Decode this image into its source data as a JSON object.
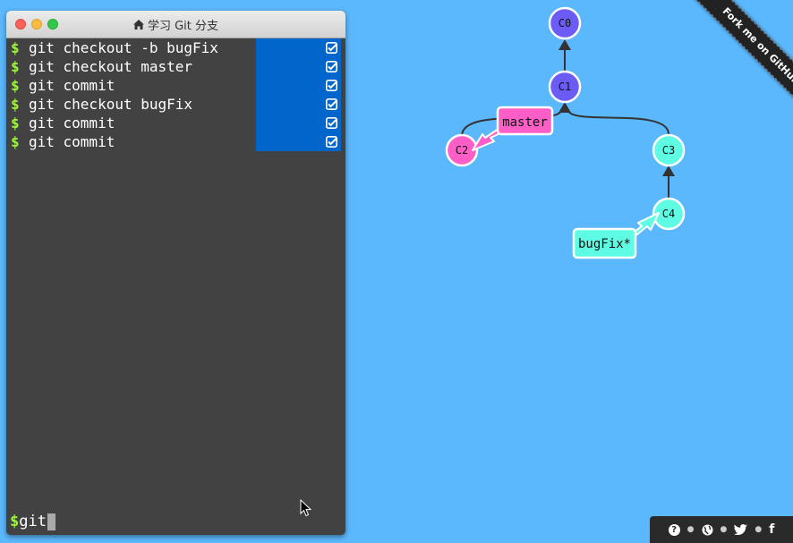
{
  "window": {
    "title": "学习 Git 分支",
    "title_icon": "home-icon"
  },
  "commands": [
    {
      "text": "git checkout -b bugFix",
      "done": true
    },
    {
      "text": "git checkout master",
      "done": true
    },
    {
      "text": "git commit",
      "done": true
    },
    {
      "text": "git checkout bugFix",
      "done": true
    },
    {
      "text": "git commit",
      "done": true
    },
    {
      "text": "git commit",
      "done": true
    }
  ],
  "prompt": {
    "symbol": "$",
    "input_value": "git"
  },
  "graph": {
    "commits": [
      "C0",
      "C1",
      "C2",
      "C3",
      "C4"
    ],
    "branches": [
      {
        "name": "master",
        "target": "C2",
        "color": "#ff5ec6"
      },
      {
        "name": "bugFix*",
        "target": "C4",
        "color": "#5efce3"
      }
    ],
    "colors": {
      "main": "#6b5cf5",
      "master": "#ff5ec6",
      "bugfix": "#5efce3"
    }
  },
  "ribbon": {
    "label": "Fork me on GitHub"
  },
  "footer": {
    "icons": [
      "help-icon",
      "globe-icon",
      "twitter-icon",
      "facebook-icon"
    ],
    "help": "?",
    "facebook": "f"
  }
}
